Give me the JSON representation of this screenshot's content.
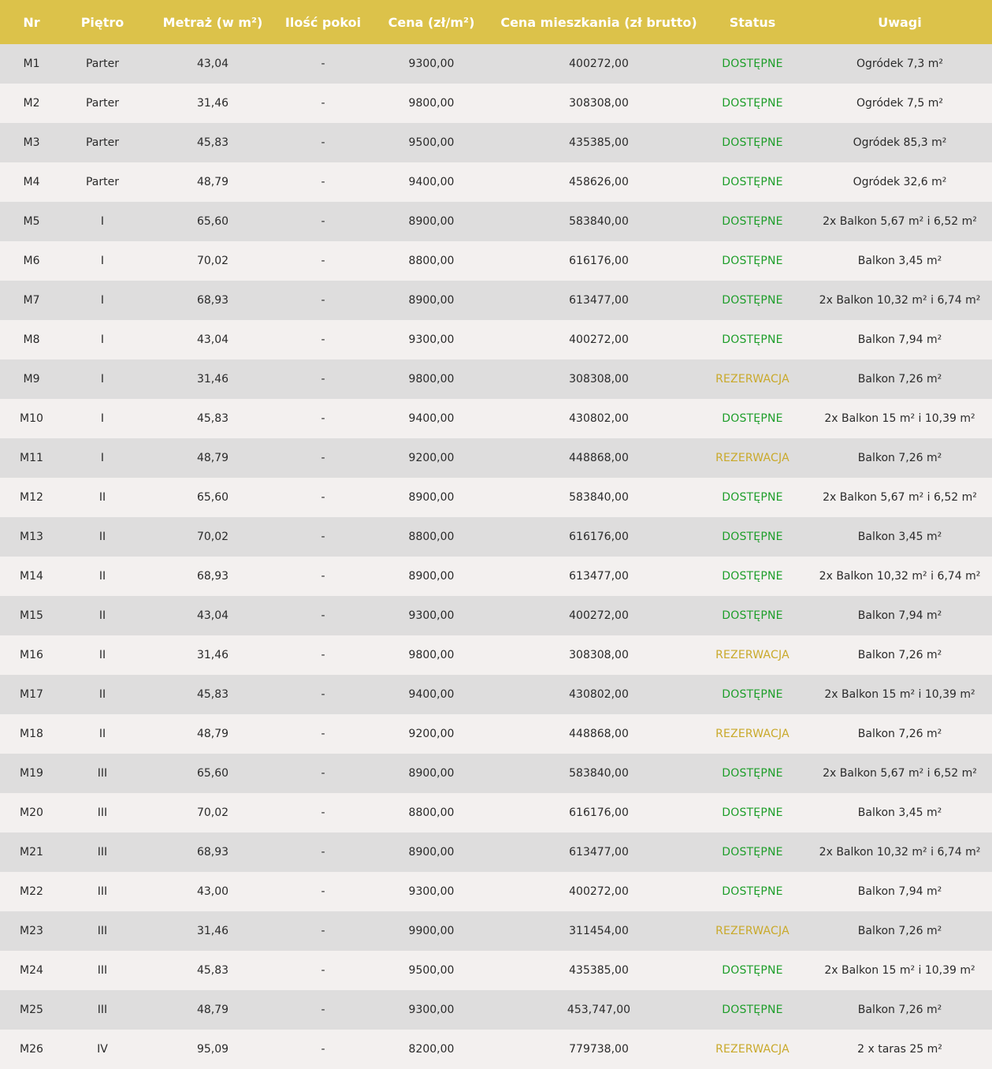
{
  "colors": {
    "header_bg": "#dcc24a",
    "header_text": "#ffffff",
    "row_odd": "#dedddd",
    "row_even": "#f3f0ef",
    "status_DOSTĘPNE": "#1e9e2a",
    "status_REZERWACJA": "#c9a92a"
  },
  "headers": [
    "Nr",
    "Piętro",
    "Metraż (w m²)",
    "Ilość pokoi",
    "Cena (zł/m²)",
    "Cena mieszkania (zł brutto)",
    "Status",
    "Uwagi"
  ],
  "rows": [
    [
      "M1",
      "Parter",
      "43,04",
      "-",
      "9300,00",
      "400272,00",
      "DOSTĘPNE",
      "Ogródek 7,3 m²"
    ],
    [
      "M2",
      "Parter",
      "31,46",
      "-",
      "9800,00",
      "308308,00",
      "DOSTĘPNE",
      "Ogródek 7,5 m²"
    ],
    [
      "M3",
      "Parter",
      "45,83",
      "-",
      "9500,00",
      "435385,00",
      "DOSTĘPNE",
      "Ogródek 85,3 m²"
    ],
    [
      "M4",
      "Parter",
      "48,79",
      "-",
      "9400,00",
      "458626,00",
      "DOSTĘPNE",
      "Ogródek 32,6 m²"
    ],
    [
      "M5",
      "I",
      "65,60",
      "-",
      "8900,00",
      "583840,00",
      "DOSTĘPNE",
      "2x Balkon 5,67 m² i 6,52 m²"
    ],
    [
      "M6",
      "I",
      "70,02",
      "-",
      "8800,00",
      "616176,00",
      "DOSTĘPNE",
      "Balkon 3,45 m²"
    ],
    [
      "M7",
      "I",
      "68,93",
      "-",
      "8900,00",
      "613477,00",
      "DOSTĘPNE",
      "2x Balkon 10,32 m² i 6,74 m²"
    ],
    [
      "M8",
      "I",
      "43,04",
      "-",
      "9300,00",
      "400272,00",
      "DOSTĘPNE",
      "Balkon 7,94 m²"
    ],
    [
      "M9",
      "I",
      "31,46",
      "-",
      "9800,00",
      "308308,00",
      "REZERWACJA",
      "Balkon 7,26 m²"
    ],
    [
      "M10",
      "I",
      "45,83",
      "-",
      "9400,00",
      "430802,00",
      "DOSTĘPNE",
      "2x Balkon 15 m² i 10,39 m²"
    ],
    [
      "M11",
      "I",
      "48,79",
      "-",
      "9200,00",
      "448868,00",
      "REZERWACJA",
      "Balkon 7,26 m²"
    ],
    [
      "M12",
      "II",
      "65,60",
      "-",
      "8900,00",
      "583840,00",
      "DOSTĘPNE",
      "2x Balkon 5,67 m² i 6,52 m²"
    ],
    [
      "M13",
      "II",
      "70,02",
      "-",
      "8800,00",
      "616176,00",
      "DOSTĘPNE",
      "Balkon 3,45 m²"
    ],
    [
      "M14",
      "II",
      "68,93",
      "-",
      "8900,00",
      "613477,00",
      "DOSTĘPNE",
      "2x Balkon 10,32 m² i 6,74 m²"
    ],
    [
      "M15",
      "II",
      "43,04",
      "-",
      "9300,00",
      "400272,00",
      "DOSTĘPNE",
      "Balkon 7,94 m²"
    ],
    [
      "M16",
      "II",
      "31,46",
      "-",
      "9800,00",
      "308308,00",
      "REZERWACJA",
      "Balkon 7,26 m²"
    ],
    [
      "M17",
      "II",
      "45,83",
      "-",
      "9400,00",
      "430802,00",
      "DOSTĘPNE",
      "2x Balkon 15 m² i 10,39 m²"
    ],
    [
      "M18",
      "II",
      "48,79",
      "-",
      "9200,00",
      "448868,00",
      "REZERWACJA",
      "Balkon 7,26 m²"
    ],
    [
      "M19",
      "III",
      "65,60",
      "-",
      "8900,00",
      "583840,00",
      "DOSTĘPNE",
      "2x Balkon 5,67 m² i 6,52 m²"
    ],
    [
      "M20",
      "III",
      "70,02",
      "-",
      "8800,00",
      "616176,00",
      "DOSTĘPNE",
      "Balkon 3,45 m²"
    ],
    [
      "M21",
      "III",
      "68,93",
      "-",
      "8900,00",
      "613477,00",
      "DOSTĘPNE",
      "2x Balkon 10,32 m² i 6,74 m²"
    ],
    [
      "M22",
      "III",
      "43,00",
      "-",
      "9300,00",
      "400272,00",
      "DOSTĘPNE",
      "Balkon 7,94 m²"
    ],
    [
      "M23",
      "III",
      "31,46",
      "-",
      "9900,00",
      "311454,00",
      "REZERWACJA",
      "Balkon 7,26 m²"
    ],
    [
      "M24",
      "III",
      "45,83",
      "-",
      "9500,00",
      "435385,00",
      "DOSTĘPNE",
      "2x Balkon 15 m² i 10,39 m²"
    ],
    [
      "M25",
      "III",
      "48,79",
      "-",
      "9300,00",
      "453,747,00",
      "DOSTĘPNE",
      "Balkon 7,26 m²"
    ],
    [
      "M26",
      "IV",
      "95,09",
      "-",
      "8200,00",
      "779738,00",
      "REZERWACJA",
      "2 x taras 25 m²"
    ]
  ]
}
